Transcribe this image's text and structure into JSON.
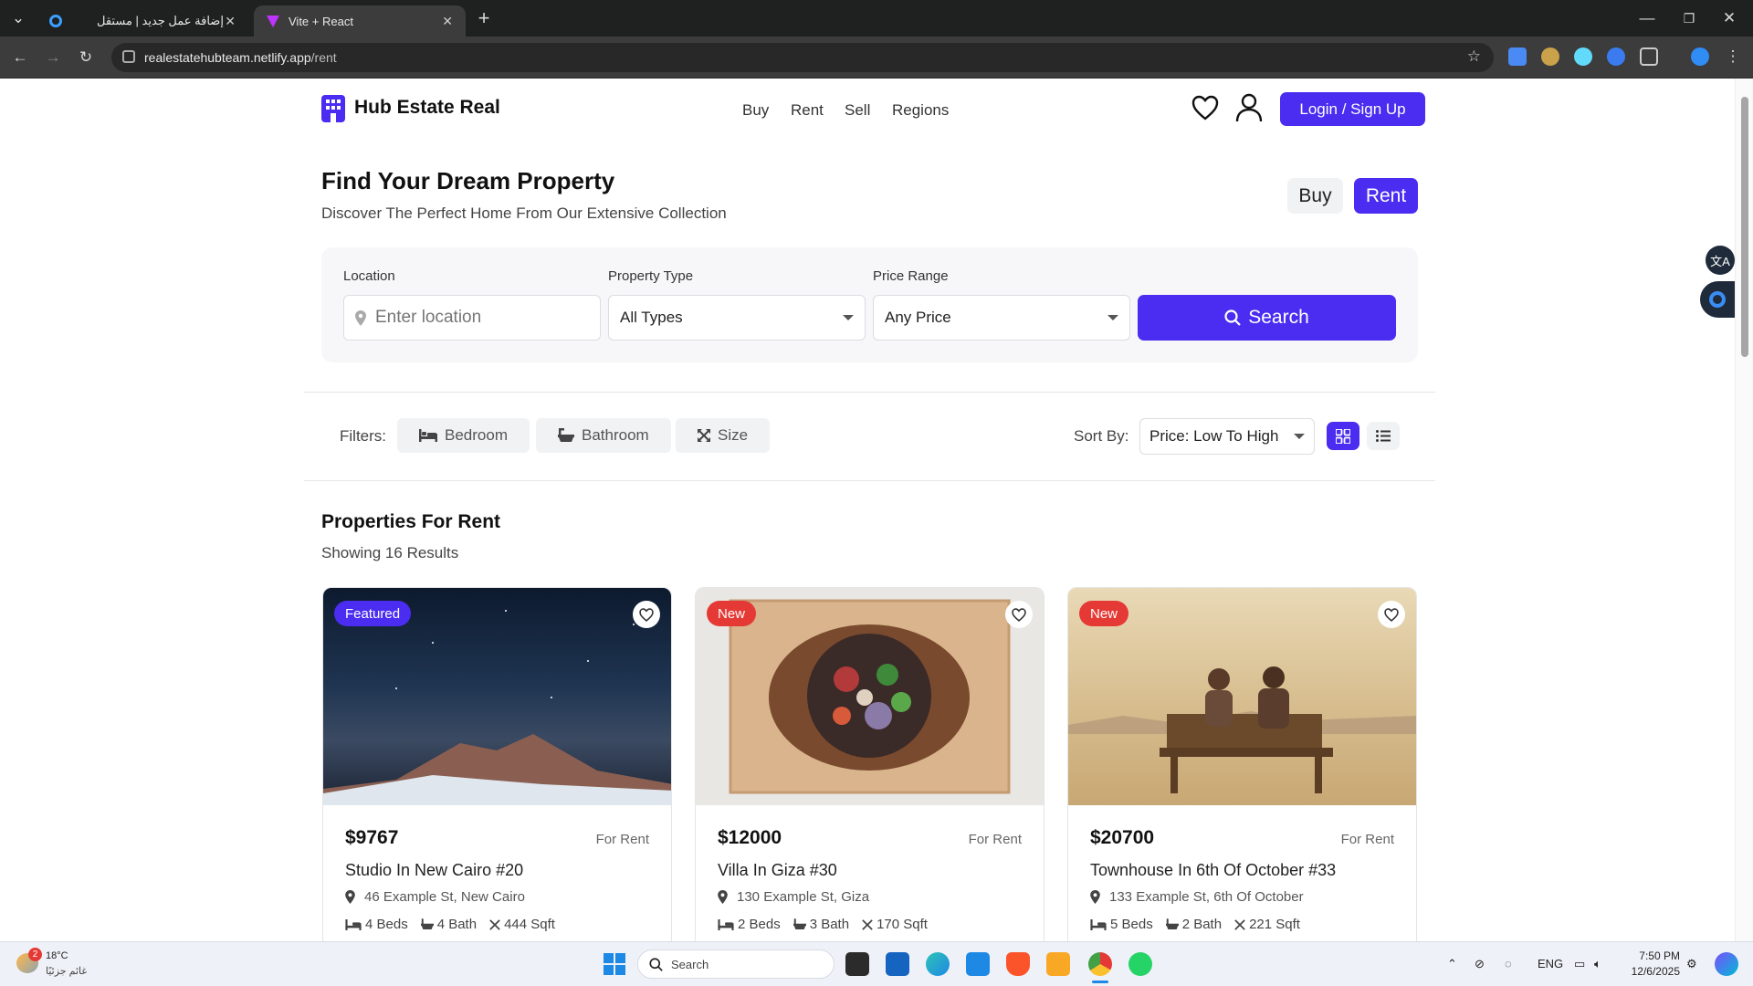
{
  "browser": {
    "tabs": [
      {
        "title": "إضافة عمل جديد | مستقل"
      },
      {
        "title": "Vite + React"
      }
    ],
    "url_host": "realestatehubteam.netlify.app",
    "url_path": "/rent"
  },
  "header": {
    "brand": "Hub Estate Real",
    "nav": [
      "Buy",
      "Rent",
      "Sell",
      "Regions"
    ],
    "login_label": "Login / Sign Up"
  },
  "hero": {
    "title": "Find Your Dream Property",
    "subtitle": "Discover The Perfect Home From Our Extensive Collection",
    "toggle": {
      "buy": "Buy",
      "rent": "Rent",
      "active": "Rent"
    }
  },
  "search": {
    "location_label": "Location",
    "location_placeholder": "Enter location",
    "type_label": "Property Type",
    "type_value": "All Types",
    "price_label": "Price Range",
    "price_value": "Any Price",
    "button": "Search"
  },
  "filters": {
    "label": "Filters:",
    "chips": [
      "Bedroom",
      "Bathroom",
      "Size"
    ],
    "sort_label": "Sort By:",
    "sort_value": "Price: Low To High"
  },
  "listing": {
    "title": "Properties For Rent",
    "count": "Showing 16 Results",
    "cards": [
      {
        "badge": "Featured",
        "badge_color": "#4a2df0",
        "price": "$9767",
        "status": "For Rent",
        "title": "Studio In New Cairo #20",
        "address": "46 Example St, New Cairo",
        "beds": "4 Beds",
        "baths": "4 Bath",
        "size": "444 Sqft"
      },
      {
        "badge": "New",
        "badge_color": "#e53935",
        "price": "$12000",
        "status": "For Rent",
        "title": "Villa In Giza #30",
        "address": "130 Example St, Giza",
        "beds": "2 Beds",
        "baths": "3 Bath",
        "size": "170 Sqft"
      },
      {
        "badge": "New",
        "badge_color": "#e53935",
        "price": "$20700",
        "status": "For Rent",
        "title": "Townhouse In 6th Of October #33",
        "address": "133 Example St, 6th Of October",
        "beds": "5 Beds",
        "baths": "2 Bath",
        "size": "221 Sqft"
      }
    ]
  },
  "taskbar": {
    "weather_temp": "18°C",
    "weather_text": "غائم جزئيًا",
    "weather_badge": "2",
    "search_label": "Search",
    "lang": "ENG",
    "time": "7:50 PM",
    "date": "12/6/2025"
  },
  "colors": {
    "accent": "#4a2df0",
    "danger": "#e53935"
  }
}
